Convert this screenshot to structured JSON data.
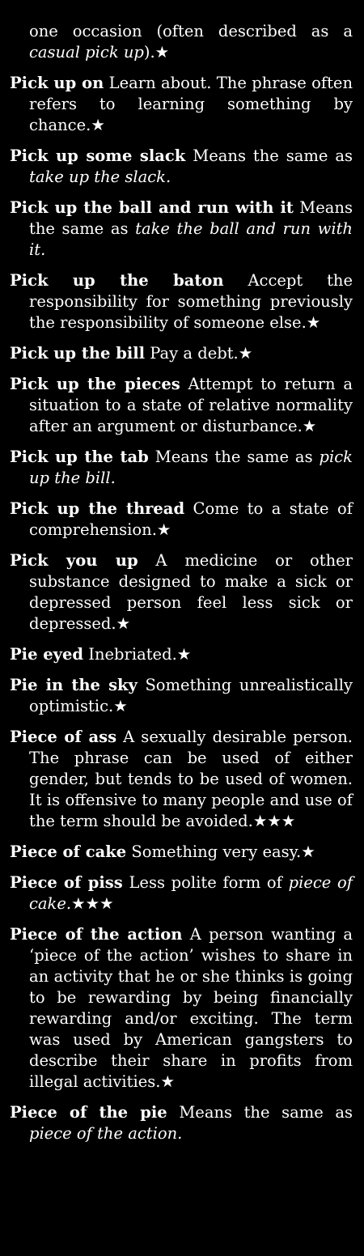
{
  "entries": [
    {
      "headword": "",
      "parts": [
        {
          "t": "one occasion (often described as a ",
          "i": false
        },
        {
          "t": "casual pick up",
          "i": true
        },
        {
          "t": ").★",
          "i": false
        }
      ]
    },
    {
      "headword": "Pick up on",
      "parts": [
        {
          "t": "Learn about. The phrase often refers to learning something by chance.★",
          "i": false
        }
      ]
    },
    {
      "headword": "Pick up some slack",
      "parts": [
        {
          "t": "Means the same as ",
          "i": false
        },
        {
          "t": "take up the slack.",
          "i": true
        }
      ]
    },
    {
      "headword": "Pick up the ball and run with it",
      "parts": [
        {
          "t": "Means the same as ",
          "i": false
        },
        {
          "t": "take the ball and run with it.",
          "i": true
        }
      ]
    },
    {
      "headword": "Pick up the baton",
      "parts": [
        {
          "t": "Accept the responsibil­ity for something previously the respon­sibility of someone else.★",
          "i": false
        }
      ]
    },
    {
      "headword": "Pick up the bill",
      "parts": [
        {
          "t": "Pay a debt.★",
          "i": false
        }
      ]
    },
    {
      "headword": "Pick up the pieces",
      "parts": [
        {
          "t": "Attempt to return a sit­uation to a state of relative normality after an argument or disturbance.★",
          "i": false
        }
      ]
    },
    {
      "headword": "Pick up the tab",
      "parts": [
        {
          "t": "Means the same as ",
          "i": false
        },
        {
          "t": "pick up the bill.",
          "i": true
        }
      ]
    },
    {
      "headword": "Pick up the thread",
      "parts": [
        {
          "t": "Come to a state of comprehension.★",
          "i": false
        }
      ]
    },
    {
      "headword": "Pick you up",
      "parts": [
        {
          "t": "A medicine or other substance designed to make a sick or depressed person feel less sick or depressed.★",
          "i": false
        }
      ]
    },
    {
      "headword": "Pie eyed",
      "parts": [
        {
          "t": "Inebriated.★",
          "i": false
        }
      ]
    },
    {
      "headword": "Pie in the sky",
      "parts": [
        {
          "t": "Something unrealistically optimistic.★",
          "i": false
        }
      ]
    },
    {
      "headword": "Piece of ass",
      "parts": [
        {
          "t": "A sexually desirable person. The phrase can be used of either gender, but tends to be used of women. It is offensive to many people and use of the term should be avoided.★★★",
          "i": false
        }
      ]
    },
    {
      "headword": "Piece of cake",
      "parts": [
        {
          "t": "Something very easy.★",
          "i": false
        }
      ]
    },
    {
      "headword": "Piece of piss",
      "parts": [
        {
          "t": "Less polite form of ",
          "i": false
        },
        {
          "t": "piece of cake.",
          "i": true
        },
        {
          "t": "★★★",
          "i": false
        }
      ]
    },
    {
      "headword": "Piece of the action",
      "parts": [
        {
          "t": "A person wanting a ‘piece of the action’ wishes to share in an activity that he or she thinks is going to be rewarding by being financially rewarding and/or exciting. The term was used by American gangsters to describe their share in profits from illegal activi­ties.★",
          "i": false
        }
      ]
    },
    {
      "headword": "Piece of the pie",
      "parts": [
        {
          "t": "Means the same as ",
          "i": false
        },
        {
          "t": "piece of the action.",
          "i": true
        }
      ]
    }
  ]
}
